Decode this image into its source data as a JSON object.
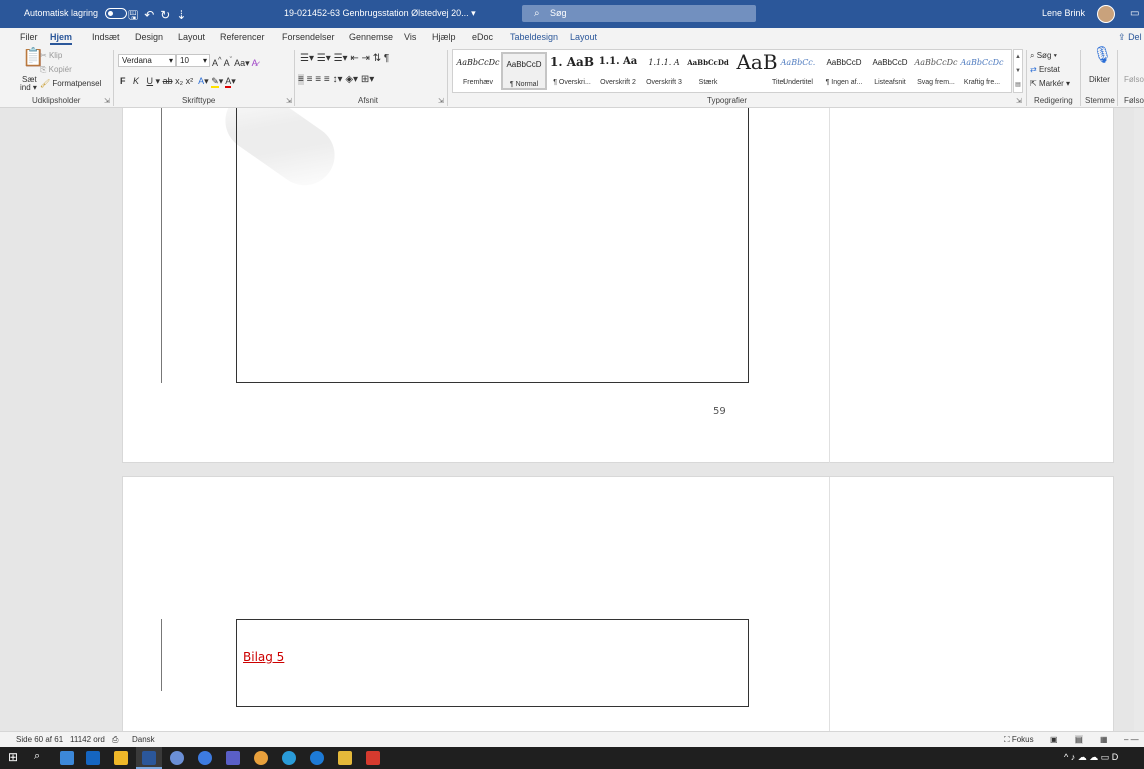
{
  "titlebar": {
    "autosave_label": "Automatisk lagring",
    "doc_title": "19-021452-63 Genbrugsstation Ølstedvej 20... ▾",
    "search_placeholder": "Søg",
    "user_name": "Lene Brink"
  },
  "tabs": [
    {
      "label": "Filer"
    },
    {
      "label": "Hjem"
    },
    {
      "label": "Indsæt"
    },
    {
      "label": "Design"
    },
    {
      "label": "Layout"
    },
    {
      "label": "Referencer"
    },
    {
      "label": "Forsendelser"
    },
    {
      "label": "Gennemse"
    },
    {
      "label": "Vis"
    },
    {
      "label": "Hjælp"
    },
    {
      "label": "eDoc"
    },
    {
      "label": "Tabeldesign"
    },
    {
      "label": "Layout"
    }
  ],
  "share_label": "Del",
  "ribbon": {
    "clipboard": {
      "paste": "Sæt",
      "paste_sub": "ind ▾",
      "cut": "Klip",
      "copy": "Kopiér",
      "format_painter": "Formatpensel",
      "label": "Udklipsholder"
    },
    "font": {
      "family": "Verdana",
      "size": "10",
      "label": "Skrifttype"
    },
    "paragraph": {
      "label": "Afsnit"
    },
    "styles": {
      "label": "Typografier",
      "items": [
        {
          "preview": "AaBbCcDc",
          "name": "Fremhæv"
        },
        {
          "preview": "AaBbCcD",
          "name": "¶ Normal"
        },
        {
          "preview": "1. AaB",
          "name": "¶ Overskri..."
        },
        {
          "preview": "1.1. Aa",
          "name": "Overskrift 2"
        },
        {
          "preview": "1.1.1. A",
          "name": "Overskrift 3"
        },
        {
          "preview": "AaBbCcDd",
          "name": "Stærk"
        },
        {
          "preview": "AaB",
          "name": "Titel"
        },
        {
          "preview": "AaBbCc.",
          "name": "Undertitel"
        },
        {
          "preview": "AaBbCcD",
          "name": "¶ Ingen af..."
        },
        {
          "preview": "AaBbCcD",
          "name": "Listeafsnit"
        },
        {
          "preview": "AaBbCcDc",
          "name": "Svag frem..."
        },
        {
          "preview": "AaBbCcDc",
          "name": "Kraftig fre..."
        }
      ]
    },
    "editing": {
      "find": "Søg ▾",
      "replace": "Erstat",
      "select": "Markér ▾",
      "label": "Redigering"
    },
    "voice": {
      "dictate": "Dikter",
      "label": "Stemme"
    },
    "sensitivity": {
      "top": "Følso",
      "label": "Følso"
    }
  },
  "document": {
    "page_number": "59",
    "bilag_link": "Bilag 5"
  },
  "statusbar": {
    "page": "Side 60 af 61",
    "words": "11142 ord",
    "language": "Dansk",
    "focus": "Fokus"
  },
  "colors": {
    "titlebar": "#2b579a",
    "link": "#c00000"
  }
}
